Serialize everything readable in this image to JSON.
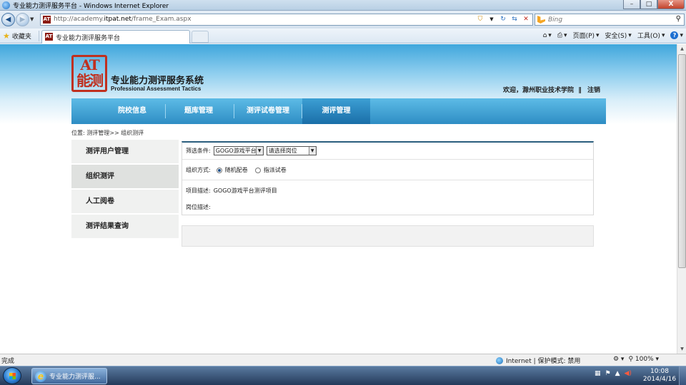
{
  "window": {
    "title": "专业能力测评服务平台 - Windows Internet Explorer",
    "buttons": {
      "minimize": "–",
      "maximize": "□",
      "close": "X"
    }
  },
  "browser": {
    "address": {
      "prefix": "http://academy.",
      "domain": "itpat.net",
      "path": "/frame_Exam.aspx"
    },
    "search_placeholder": "Bing",
    "favorites_label": "收藏夹",
    "tab_label": "专业能力测评服务平台",
    "commands": {
      "page": "页面(P)",
      "safety": "安全(S)",
      "tools": "工具(O)"
    },
    "icons": [
      "back-arrow-icon",
      "forward-arrow-icon",
      "compatibility-icon",
      "refresh-icon",
      "stop-icon",
      "search-icon",
      "star-icon",
      "home-icon",
      "print-icon",
      "help-icon"
    ]
  },
  "header": {
    "logo_glyphs": "AT 能测",
    "brand_cn": "专业能力测评服务系统",
    "brand_en": "Professional Assessment Tactics",
    "welcome": "欢迎，滁州职业技术学院",
    "divider": "‖",
    "logout": "注销"
  },
  "nav": {
    "items": [
      {
        "label": "院校信息"
      },
      {
        "label": "题库管理"
      },
      {
        "label": "测评试卷管理"
      },
      {
        "label": "测评管理",
        "active": true
      }
    ]
  },
  "breadcrumb": "位置: 测评管理>> 组织测评",
  "sidebar": {
    "items": [
      {
        "label": "测评用户管理"
      },
      {
        "label": "组织测评",
        "active": true
      },
      {
        "label": "人工阅卷"
      },
      {
        "label": "测评结果查询"
      }
    ]
  },
  "form": {
    "filter_label": "筛选条件:",
    "project_select": "GOGO游戏平台",
    "position_select": "请选择岗位",
    "method_label": "组织方式:",
    "method_options": [
      {
        "label": "随机配卷",
        "checked": true
      },
      {
        "label": "指派试卷",
        "checked": false
      }
    ],
    "project_desc_label": "项目描述:",
    "project_desc_value": "GOGO游戏平台测评项目",
    "position_desc_label": "岗位描述:",
    "position_desc_value": ""
  },
  "statusbar": {
    "left": "完成",
    "zone": "Internet | 保护模式: 禁用",
    "zoom": "100%"
  },
  "taskbar": {
    "task_label": "专业能力测评服...",
    "time": "10:08",
    "date": "2014/4/16"
  },
  "colors": {
    "nav_bg": "#2e8dc4",
    "seal_red": "#c0301f",
    "panel_border_top": "#2a5d7d"
  }
}
